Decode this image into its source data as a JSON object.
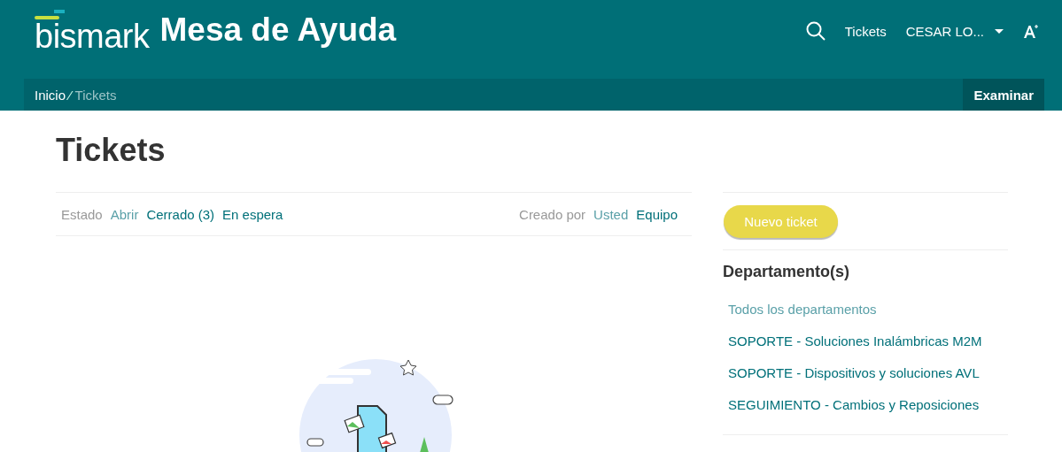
{
  "header": {
    "logo": "bismark",
    "title": "Mesa de Ayuda",
    "nav": [
      {
        "kind": "search"
      },
      {
        "kind": "link",
        "label": "Tickets"
      },
      {
        "kind": "user",
        "label": "CESAR LO..."
      },
      {
        "kind": "font"
      }
    ]
  },
  "breadcrumb": {
    "items": [
      {
        "label": "Inicio",
        "selected": false
      },
      {
        "label": "Tickets",
        "selected": true
      }
    ],
    "separator": "⁄",
    "button": "Examinar"
  },
  "page_title": "Tickets",
  "filters": {
    "status_label": "Estado",
    "status": [
      {
        "label": "Abrir",
        "selected": true
      },
      {
        "label": "Cerrado (3)",
        "selected": false
      },
      {
        "label": "En espera",
        "selected": false
      }
    ],
    "creator_label": "Creado por",
    "creators": [
      {
        "label": "Usted",
        "selected": true
      },
      {
        "label": "Equipo",
        "selected": false
      }
    ]
  },
  "sidebar": {
    "new_button": "Nuevo ticket",
    "departments_title": "Departamento(s)",
    "departments": [
      {
        "label": "Todos los departamentos",
        "selected": true
      },
      {
        "label": "SOPORTE - Soluciones Inalámbricas M2M",
        "selected": false
      },
      {
        "label": "SOPORTE - Dispositivos y soluciones AVL",
        "selected": false
      },
      {
        "label": "SEGUIMIENTO - Cambios y Reposiciones",
        "selected": false
      }
    ]
  }
}
